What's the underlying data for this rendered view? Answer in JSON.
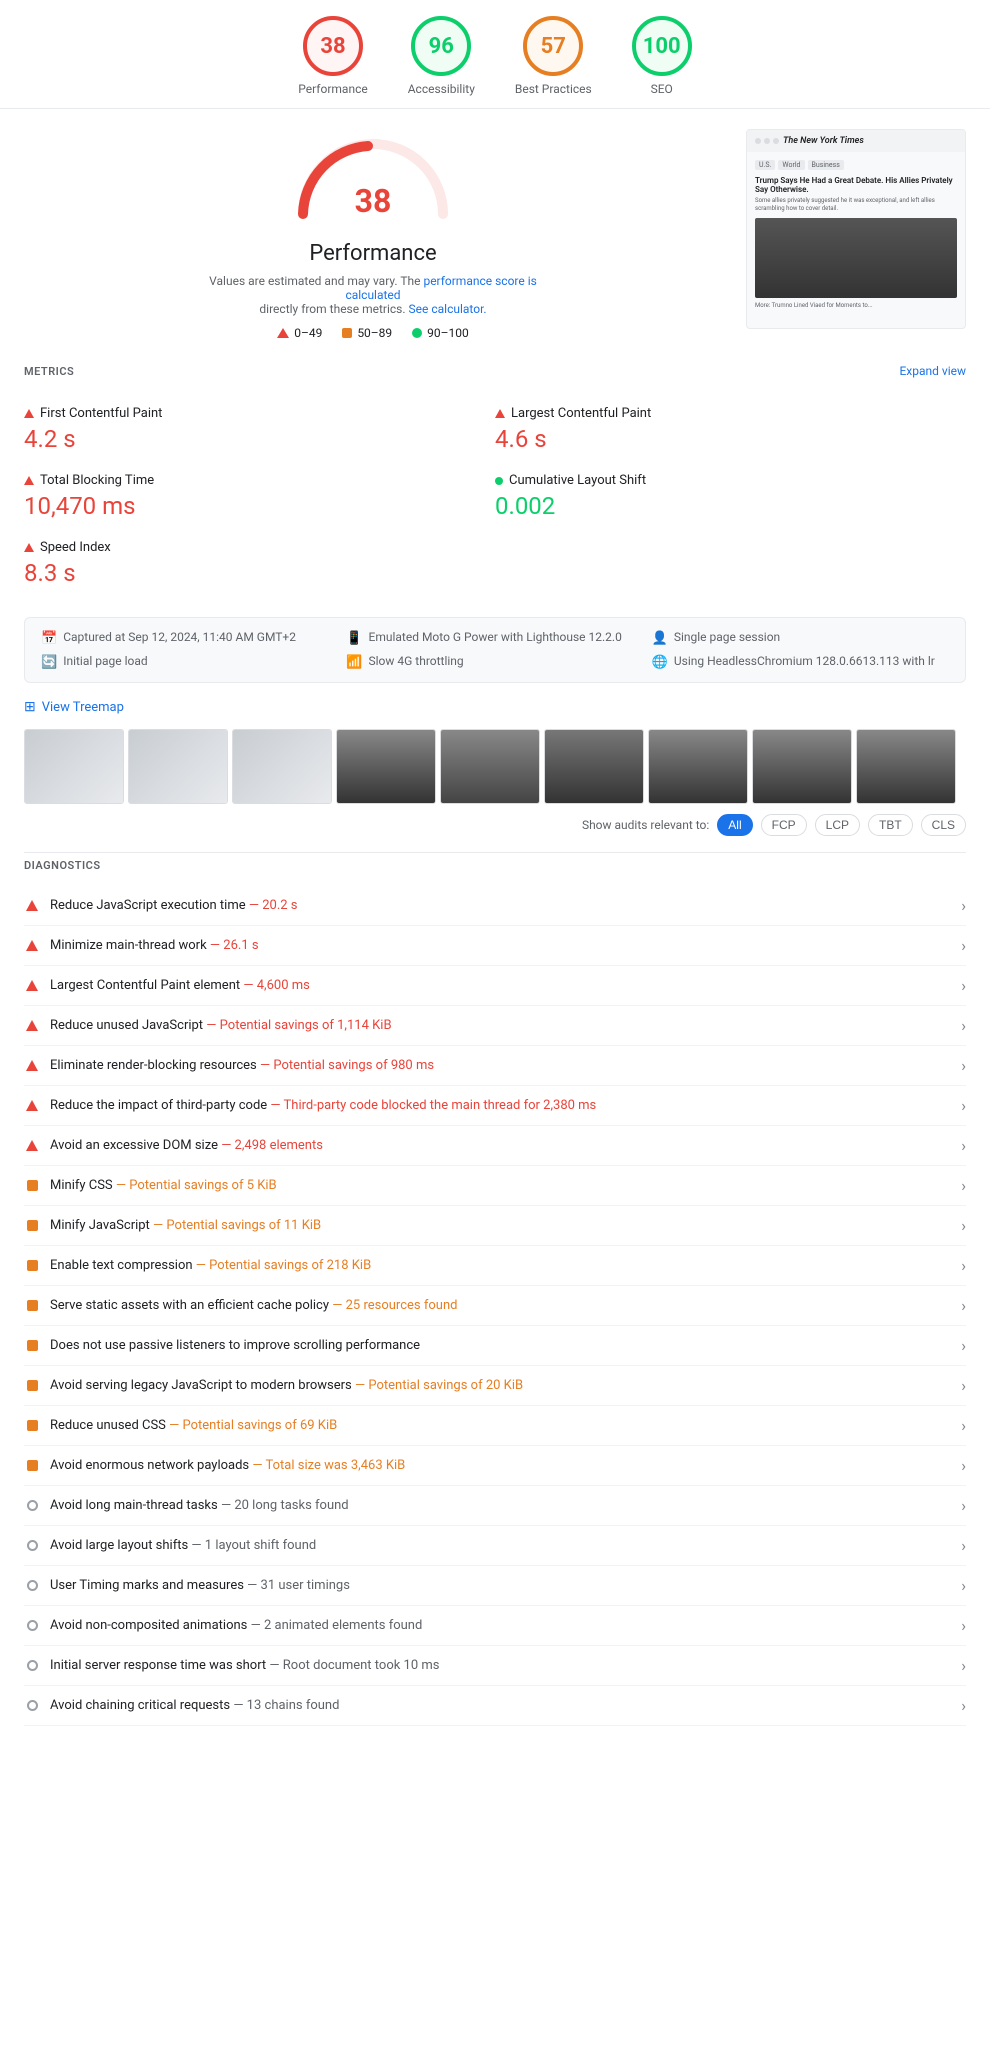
{
  "scores": [
    {
      "id": "performance",
      "value": "38",
      "label": "Performance",
      "class": "score-red"
    },
    {
      "id": "accessibility",
      "value": "96",
      "label": "Accessibility",
      "class": "score-green"
    },
    {
      "id": "best-practices",
      "value": "57",
      "label": "Best Practices",
      "class": "score-orange"
    },
    {
      "id": "seo",
      "value": "100",
      "label": "SEO",
      "class": "score-green2"
    }
  ],
  "perf": {
    "score": "38",
    "title": "Performance",
    "desc_text": "Values are estimated and may vary. The",
    "desc_link": "performance score is calculated",
    "desc_mid": "directly from these metrics.",
    "desc_link2": "See calculator.",
    "legend": [
      {
        "type": "triangle",
        "range": "0–49"
      },
      {
        "type": "square",
        "range": "50–89"
      },
      {
        "type": "dot-green",
        "range": "90–100"
      }
    ]
  },
  "metrics": {
    "header": "METRICS",
    "expand": "Expand view",
    "items": [
      {
        "name": "First Contentful Paint",
        "value": "4.2 s",
        "color": "red",
        "icon": "triangle"
      },
      {
        "name": "Largest Contentful Paint",
        "value": "4.6 s",
        "color": "red",
        "icon": "triangle"
      },
      {
        "name": "Total Blocking Time",
        "value": "10,470 ms",
        "color": "red",
        "icon": "triangle"
      },
      {
        "name": "Cumulative Layout Shift",
        "value": "0.002",
        "color": "green",
        "icon": "dot"
      },
      {
        "name": "Speed Index",
        "value": "8.3 s",
        "color": "red",
        "icon": "triangle"
      }
    ]
  },
  "infobar": [
    {
      "icon": "📅",
      "text": "Captured at Sep 12, 2024, 11:40 AM GMT+2"
    },
    {
      "icon": "📱",
      "text": "Emulated Moto G Power with Lighthouse 12.2.0"
    },
    {
      "icon": "👤",
      "text": "Single page session"
    },
    {
      "icon": "🔄",
      "text": "Initial page load"
    },
    {
      "icon": "📶",
      "text": "Slow 4G throttling"
    },
    {
      "icon": "🌐",
      "text": "Using HeadlessChromium 128.0.6613.113 with lr"
    }
  ],
  "treemap": "View Treemap",
  "filter": {
    "label": "Show audits relevant to:",
    "buttons": [
      "All",
      "FCP",
      "LCP",
      "TBT",
      "CLS"
    ],
    "active": "All"
  },
  "diagnostics_header": "DIAGNOSTICS",
  "audits": [
    {
      "icon": "triangle",
      "text": "Reduce JavaScript execution time",
      "detail": "— 20.2 s",
      "detail_type": "red"
    },
    {
      "icon": "triangle",
      "text": "Minimize main-thread work",
      "detail": "— 26.1 s",
      "detail_type": "red"
    },
    {
      "icon": "triangle",
      "text": "Largest Contentful Paint element",
      "detail": "— 4,600 ms",
      "detail_type": "red"
    },
    {
      "icon": "triangle",
      "text": "Reduce unused JavaScript",
      "detail": "— Potential savings of 1,114 KiB",
      "detail_type": "red"
    },
    {
      "icon": "triangle",
      "text": "Eliminate render-blocking resources",
      "detail": "— Potential savings of 980 ms",
      "detail_type": "red"
    },
    {
      "icon": "triangle",
      "text": "Reduce the impact of third-party code",
      "detail": "— Third-party code blocked the main thread for 2,380 ms",
      "detail_type": "red"
    },
    {
      "icon": "triangle",
      "text": "Avoid an excessive DOM size",
      "detail": "— 2,498 elements",
      "detail_type": "red"
    },
    {
      "icon": "square",
      "text": "Minify CSS",
      "detail": "— Potential savings of 5 KiB",
      "detail_type": "orange"
    },
    {
      "icon": "square",
      "text": "Minify JavaScript",
      "detail": "— Potential savings of 11 KiB",
      "detail_type": "orange"
    },
    {
      "icon": "square",
      "text": "Enable text compression",
      "detail": "— Potential savings of 218 KiB",
      "detail_type": "orange"
    },
    {
      "icon": "square",
      "text": "Serve static assets with an efficient cache policy",
      "detail": "— 25 resources found",
      "detail_type": "orange"
    },
    {
      "icon": "square",
      "text": "Does not use passive listeners to improve scrolling performance",
      "detail": "",
      "detail_type": "none"
    },
    {
      "icon": "square",
      "text": "Avoid serving legacy JavaScript to modern browsers",
      "detail": "— Potential savings of 20 KiB",
      "detail_type": "orange"
    },
    {
      "icon": "square",
      "text": "Reduce unused CSS",
      "detail": "— Potential savings of 69 KiB",
      "detail_type": "orange"
    },
    {
      "icon": "square",
      "text": "Avoid enormous network payloads",
      "detail": "— Total size was 3,463 KiB",
      "detail_type": "orange"
    },
    {
      "icon": "circle",
      "text": "Avoid long main-thread tasks",
      "detail": "— 20 long tasks found",
      "detail_type": "gray"
    },
    {
      "icon": "circle",
      "text": "Avoid large layout shifts",
      "detail": "— 1 layout shift found",
      "detail_type": "gray"
    },
    {
      "icon": "circle",
      "text": "User Timing marks and measures",
      "detail": "— 31 user timings",
      "detail_type": "gray"
    },
    {
      "icon": "circle",
      "text": "Avoid non-composited animations",
      "detail": "— 2 animated elements found",
      "detail_type": "gray"
    },
    {
      "icon": "circle",
      "text": "Initial server response time was short",
      "detail": "— Root document took 10 ms",
      "detail_type": "gray"
    },
    {
      "icon": "circle",
      "text": "Avoid chaining critical requests",
      "detail": "— 13 chains found",
      "detail_type": "gray"
    }
  ],
  "thumb": {
    "header": "The New York Times",
    "title": "Trump Says He Had a Great Debate. His Allies Privately Say Otherwise.",
    "text": "Some allies privately suggested he it was exceptional, and left allies scrambling how to cover detail.",
    "bottom": "More: Trumno Lined Viaed for Moments to..."
  }
}
